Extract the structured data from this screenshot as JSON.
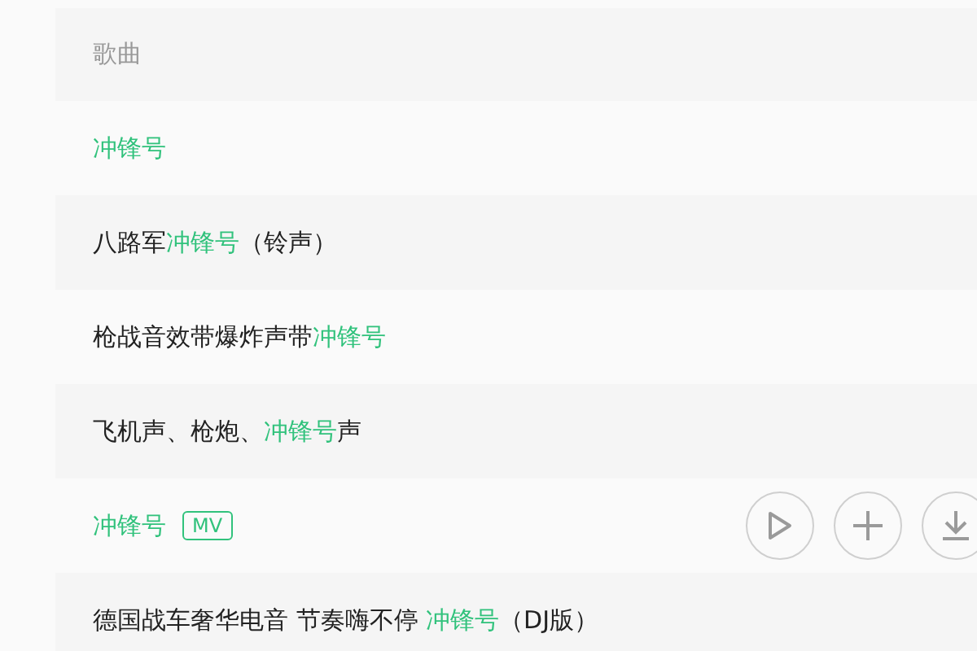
{
  "header": {
    "label": "歌曲"
  },
  "songs": [
    {
      "hovered": false,
      "segments": [
        {
          "text": "冲锋号",
          "highlight": true
        }
      ]
    },
    {
      "hovered": false,
      "segments": [
        {
          "text": "八路军",
          "highlight": false
        },
        {
          "text": "冲锋号",
          "highlight": true
        },
        {
          "text": "（铃声）",
          "highlight": false
        }
      ]
    },
    {
      "hovered": false,
      "segments": [
        {
          "text": "枪战音效带爆炸声带",
          "highlight": false
        },
        {
          "text": "冲锋号",
          "highlight": true
        }
      ]
    },
    {
      "hovered": false,
      "segments": [
        {
          "text": "飞机声、枪炮、",
          "highlight": false
        },
        {
          "text": "冲锋号",
          "highlight": true
        },
        {
          "text": "声",
          "highlight": false
        }
      ]
    },
    {
      "hovered": true,
      "badge": "MV",
      "segments": [
        {
          "text": "冲锋号",
          "highlight": true
        }
      ]
    },
    {
      "hovered": false,
      "segments": [
        {
          "text": "德国战车奢华电音 节奏嗨不停 ",
          "highlight": false
        },
        {
          "text": "冲锋号",
          "highlight": true
        },
        {
          "text": "（DJ版）",
          "highlight": false
        }
      ]
    }
  ]
}
